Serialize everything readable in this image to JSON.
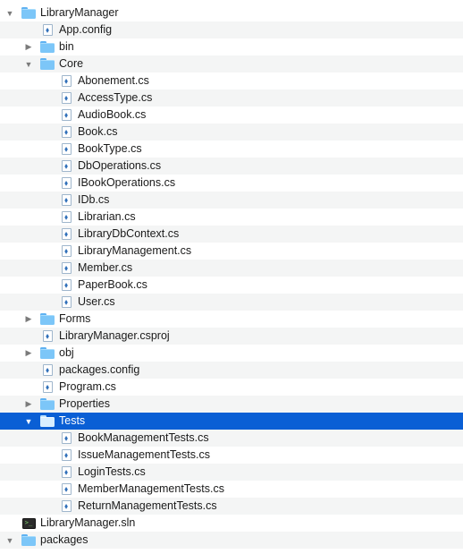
{
  "tree": {
    "rows": [
      {
        "label": "LibraryManager",
        "icon": "folder-icon",
        "state": "expanded"
      },
      {
        "label": "App.config",
        "icon": "file-icon",
        "state": ""
      },
      {
        "label": "bin",
        "icon": "folder-icon",
        "state": "collapsed"
      },
      {
        "label": "Core",
        "icon": "folder-icon",
        "state": "expanded"
      },
      {
        "label": "Abonement.cs",
        "icon": "file-icon",
        "state": ""
      },
      {
        "label": "AccessType.cs",
        "icon": "file-icon",
        "state": ""
      },
      {
        "label": "AudioBook.cs",
        "icon": "file-icon",
        "state": ""
      },
      {
        "label": "Book.cs",
        "icon": "file-icon",
        "state": ""
      },
      {
        "label": "BookType.cs",
        "icon": "file-icon",
        "state": ""
      },
      {
        "label": "DbOperations.cs",
        "icon": "file-icon",
        "state": ""
      },
      {
        "label": "IBookOperations.cs",
        "icon": "file-icon",
        "state": ""
      },
      {
        "label": "IDb.cs",
        "icon": "file-icon",
        "state": ""
      },
      {
        "label": "Librarian.cs",
        "icon": "file-icon",
        "state": ""
      },
      {
        "label": "LibraryDbContext.cs",
        "icon": "file-icon",
        "state": ""
      },
      {
        "label": "LibraryManagement.cs",
        "icon": "file-icon",
        "state": ""
      },
      {
        "label": "Member.cs",
        "icon": "file-icon",
        "state": ""
      },
      {
        "label": "PaperBook.cs",
        "icon": "file-icon",
        "state": ""
      },
      {
        "label": "User.cs",
        "icon": "file-icon",
        "state": ""
      },
      {
        "label": "Forms",
        "icon": "folder-icon",
        "state": "collapsed"
      },
      {
        "label": "LibraryManager.csproj",
        "icon": "file-icon",
        "state": ""
      },
      {
        "label": "obj",
        "icon": "folder-icon",
        "state": "collapsed"
      },
      {
        "label": "packages.config",
        "icon": "file-icon",
        "state": ""
      },
      {
        "label": "Program.cs",
        "icon": "file-icon",
        "state": ""
      },
      {
        "label": "Properties",
        "icon": "folder-icon",
        "state": "collapsed"
      },
      {
        "label": "Tests",
        "icon": "folder-icon",
        "state": "expanded",
        "selected": true
      },
      {
        "label": "BookManagementTests.cs",
        "icon": "file-icon",
        "state": ""
      },
      {
        "label": "IssueManagementTests.cs",
        "icon": "file-icon",
        "state": ""
      },
      {
        "label": "LoginTests.cs",
        "icon": "file-icon",
        "state": ""
      },
      {
        "label": "MemberManagementTests.cs",
        "icon": "file-icon",
        "state": ""
      },
      {
        "label": "ReturnManagementTests.cs",
        "icon": "file-icon",
        "state": ""
      },
      {
        "label": "LibraryManager.sln",
        "icon": "solution-icon",
        "state": ""
      },
      {
        "label": "packages",
        "icon": "folder-icon",
        "state": "expanded"
      }
    ]
  },
  "colors": {
    "selection": "#0a5fd5",
    "folder": "#7cc6f8",
    "stripe": "#f4f5f5"
  }
}
